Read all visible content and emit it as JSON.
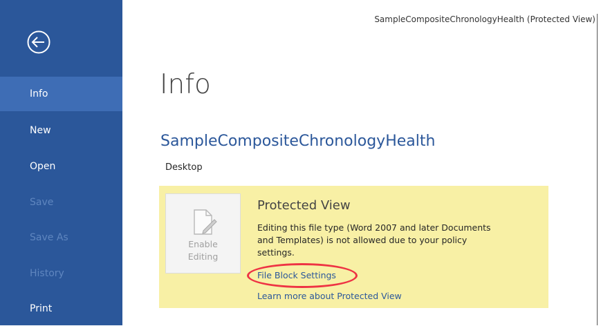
{
  "window": {
    "title": "SampleCompositeChronologyHealth (Protected View)"
  },
  "sidebar": {
    "back_icon": "back-arrow-circle-icon",
    "items": [
      {
        "label": "Info",
        "state": "active"
      },
      {
        "label": "New",
        "state": "enabled"
      },
      {
        "label": "Open",
        "state": "enabled"
      },
      {
        "label": "Save",
        "state": "disabled"
      },
      {
        "label": "Save As",
        "state": "disabled"
      },
      {
        "label": "History",
        "state": "disabled"
      },
      {
        "label": "Print",
        "state": "enabled"
      }
    ]
  },
  "main": {
    "title": "Info",
    "doc_name": "SampleCompositeChronologyHealth",
    "doc_location": "Desktop",
    "protected_view": {
      "enable_label": "Enable\nEditing",
      "enable_icon": "document-edit-icon",
      "heading": "Protected View",
      "message": "Editing this file type (Word 2007 and later Documents\nand Templates) is not allowed due to your policy\nsettings.",
      "link_file_block": "File Block Settings",
      "link_learn_more": "Learn more about Protected View"
    }
  },
  "colors": {
    "sidebar_bg": "#2b579a",
    "sidebar_active": "#3e6db5",
    "accent_text": "#2b579a",
    "panel_bg": "#f8f0a5",
    "highlight": "#ee3344"
  }
}
